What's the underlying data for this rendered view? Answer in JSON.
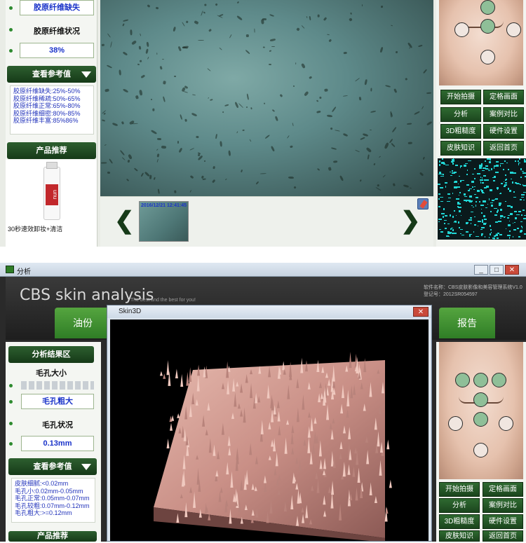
{
  "top_window": {
    "left_panel": {
      "first_value": "胶原纤维缺失",
      "status_label": "胶原纤维状况",
      "percent_value": "38%",
      "reference_button": "查看参考值",
      "reference_items": [
        "胶原纤维缺失:25%-50%",
        "胶原纤维稀疏:50%-65%",
        "胶原纤维正常:65%-80%",
        "胶原纤维细密:80%-85%",
        "胶原纤维丰富:85%86%"
      ],
      "product_button": "产品推荐",
      "product_name": "30秒速效卸妆+清洁",
      "product_brand_text": "unu"
    },
    "thumbnail_timestamp": "2016/12/21 12:41:45",
    "arrow_left": "❮",
    "arrow_right": "❯",
    "buttons": [
      "开始拍摄",
      "定格画面",
      "分析",
      "案例对比",
      "3D粗糙度",
      "硬件设置",
      "皮肤知识",
      "返回首页"
    ]
  },
  "bottom_window": {
    "window_title": "分析",
    "logo_text": "CBS skin analysis",
    "tagline": "The best and the best for you!",
    "software_name": "软件名称：CBS皮肤影像和美容管理系统V1.0",
    "registration": "登记号：2012SR054597",
    "tab_left": "油份",
    "tab_right": "报告",
    "dialog_title": "Skin3D",
    "dialog_close": "✕",
    "left_panel": {
      "analysis_area": "分析结果区",
      "pore_size_label": "毛孔大小",
      "pore_value": "毛孔粗大",
      "pore_status_label": "毛孔状况",
      "pore_mm": "0.13mm",
      "reference_button": "查看参考值",
      "reference_items": [
        "皮肤细腻:<0.02mm",
        "毛孔小:0.02mm-0.05mm",
        "毛孔正常:0.05mm-0.07mm",
        "毛孔较粗:0.07mm-0.12mm",
        "毛孔粗大:>=0.12mm"
      ],
      "product_button": "产品推荐"
    },
    "buttons": [
      "开始拍摄",
      "定格画面",
      "分析",
      "案例对比",
      "3D粗糙度",
      "硬件设置",
      "皮肤知识",
      "返回首页"
    ],
    "window_buttons": [
      "_",
      "□",
      "✕"
    ]
  },
  "colors": {
    "dark_green": "#163a18",
    "accent_green": "#2f7d26",
    "value_blue": "#1a33c9",
    "heat_cyan": "#21d7d6",
    "skin3d_pink": "#d7a49a"
  }
}
